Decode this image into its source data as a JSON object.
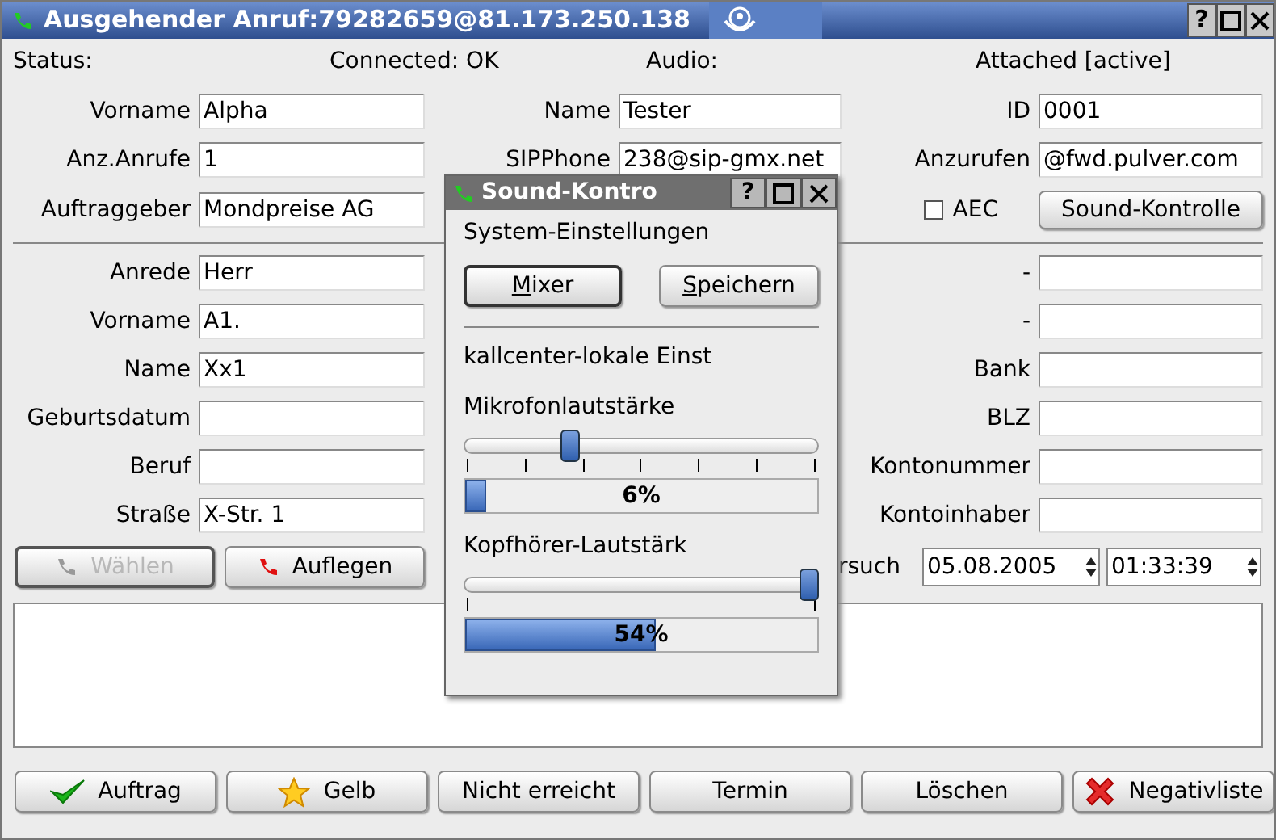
{
  "window": {
    "title": "Ausgehender Anruf:79282659@81.173.250.138",
    "help_button": "?"
  },
  "status": {
    "label": "Status:",
    "connection": "Connected: OK",
    "audio_label": "Audio:",
    "audio": "Attached [active]"
  },
  "top_rows": [
    [
      {
        "kind": "field",
        "label": "Vorname",
        "value": "Alpha"
      },
      {
        "kind": "field",
        "label": "Name",
        "value": "Tester"
      },
      {
        "kind": "field",
        "label": "ID",
        "value": "0001"
      }
    ],
    [
      {
        "kind": "field",
        "label": "Anz.Anrufe",
        "value": "1"
      },
      {
        "kind": "field",
        "label": "SIPPhone",
        "value": "238@sip-gmx.net"
      },
      {
        "kind": "field",
        "label": "Anzurufen",
        "value": "@fwd.pulver.com"
      }
    ],
    [
      {
        "kind": "field",
        "label": "Auftraggeber",
        "value": "Mondpreise AG"
      },
      {
        "kind": "hidden"
      },
      {
        "kind": "controls",
        "checkbox": {
          "label": "AEC",
          "checked": false
        },
        "button": "Sound-Kontrolle"
      }
    ]
  ],
  "bottom_rows": [
    {
      "left": {
        "label": "Anrede",
        "value": "Herr"
      },
      "right": {
        "label": "-"
      }
    },
    {
      "left": {
        "label": "Vorname",
        "value": "A1."
      },
      "right": {
        "label": "-"
      }
    },
    {
      "left": {
        "label": "Name",
        "value": "Xx1"
      },
      "right": {
        "label": "Bank"
      }
    },
    {
      "left": {
        "label": "Geburtsdatum"
      },
      "right": {
        "label": "BLZ"
      }
    },
    {
      "left": {
        "label": "Beruf"
      },
      "right": {
        "label": "Kontonummer"
      }
    },
    {
      "left": {
        "label": "Straße",
        "value": "X-Str. 1"
      },
      "right": {
        "label": "Kontoinhaber"
      }
    }
  ],
  "call_buttons": [
    {
      "label": "Wählen",
      "kind": "dial",
      "disabled": true
    },
    {
      "label": "Auflegen",
      "kind": "hangup",
      "disabled": false
    }
  ],
  "attempt": {
    "label": "rsuch",
    "date": "05.08.2005",
    "time": "01:33:39"
  },
  "actions": [
    {
      "label": "Auftrag",
      "kind": "check"
    },
    {
      "label": "Gelb",
      "kind": "star"
    },
    {
      "label": "Nicht erreicht",
      "kind": "plain"
    },
    {
      "label": "Termin",
      "kind": "plain"
    },
    {
      "label": "Löschen",
      "kind": "plain"
    },
    {
      "label": "Negativliste",
      "kind": "cross"
    }
  ],
  "sound_dialog": {
    "title": "Sound-Kontro",
    "help_button": "?",
    "section": "System-Einstellungen",
    "buttons": [
      {
        "label": "Mixer",
        "default": true
      },
      {
        "label": "Speichern",
        "default": false
      }
    ],
    "local_section": "kallcenter-lokale Einst",
    "sliders": [
      {
        "label": "Mikrofonlautstärke",
        "level": 0.29,
        "kind": "fine_ticks",
        "meter": {
          "level": 0.06,
          "reading": "6%"
        }
      },
      {
        "label": "Kopfhörer-Lautstärk",
        "level": 1,
        "kind": "end_ticks",
        "meter": {
          "level": 0.54,
          "reading": "54%"
        }
      }
    ]
  }
}
